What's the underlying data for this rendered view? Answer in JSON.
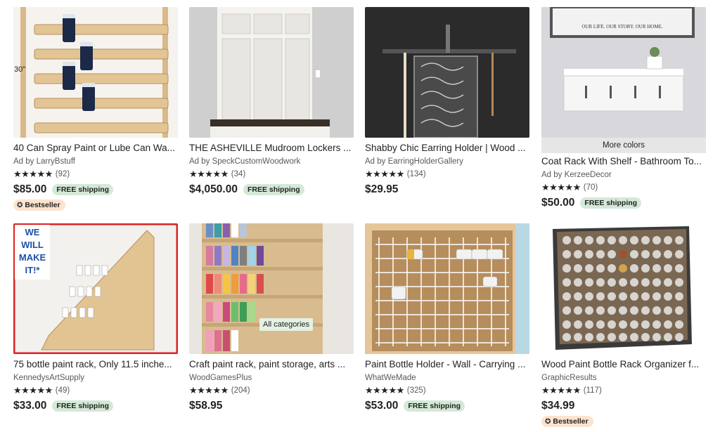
{
  "listings": [
    {
      "title": "40 Can Spray Paint or Lube Can Wa...",
      "seller": "Ad by LarryBstuff",
      "stars": "★★★★★",
      "count": "(92)",
      "price": "$85.00",
      "shipping": "FREE shipping",
      "bestseller": "Bestseller",
      "image_label": "30\""
    },
    {
      "title": "THE ASHEVILLE Mudroom Lockers ...",
      "seller": "Ad by SpeckCustomWoodwork",
      "stars": "★★★★★",
      "count": "(34)",
      "price": "$4,050.00",
      "shipping": "FREE shipping"
    },
    {
      "title": "Shabby Chic Earring Holder | Wood ...",
      "seller": "Ad by EarringHolderGallery",
      "stars": "★★★★★",
      "count": "(134)",
      "price": "$29.95"
    },
    {
      "title": "Coat Rack With Shelf - Bathroom To...",
      "seller": "Ad by KerzeeDecor",
      "stars": "★★★★★",
      "count": "(70)",
      "price": "$50.00",
      "shipping": "FREE shipping",
      "more_colors": "More colors",
      "image_text": "OUR LIFE. OUR STORY. OUR HOME."
    },
    {
      "title": "75 bottle paint rack, Only 11.5 inche...",
      "seller": "KennedysArtSupply",
      "stars": "★★★★★",
      "count": "(49)",
      "price": "$33.00",
      "shipping": "FREE shipping",
      "image_text": [
        "WE",
        "WILL",
        "MAKE",
        "IT!*"
      ]
    },
    {
      "title": "Craft paint rack, paint storage, arts ...",
      "seller": "WoodGamesPlus",
      "stars": "★★★★★",
      "count": "(204)",
      "price": "$58.95",
      "overlay": "All categories"
    },
    {
      "title": "Paint Bottle Holder - Wall - Carrying ...",
      "seller": "WhatWeMade",
      "stars": "★★★★★",
      "count": "(325)",
      "price": "$53.00",
      "shipping": "FREE shipping"
    },
    {
      "title": "Wood Paint Bottle Rack Organizer f...",
      "seller": "GraphicResults",
      "stars": "★★★★★",
      "count": "(117)",
      "price": "$34.99",
      "bestseller": "Bestseller"
    }
  ],
  "colors": {
    "ship_badge": "#d4e9d7",
    "bestseller_badge": "#fbe3cf",
    "more_colors_bar": "#e6e6e6"
  },
  "icons": {
    "bestseller": "award-ribbon-icon",
    "star": "star-icon"
  }
}
